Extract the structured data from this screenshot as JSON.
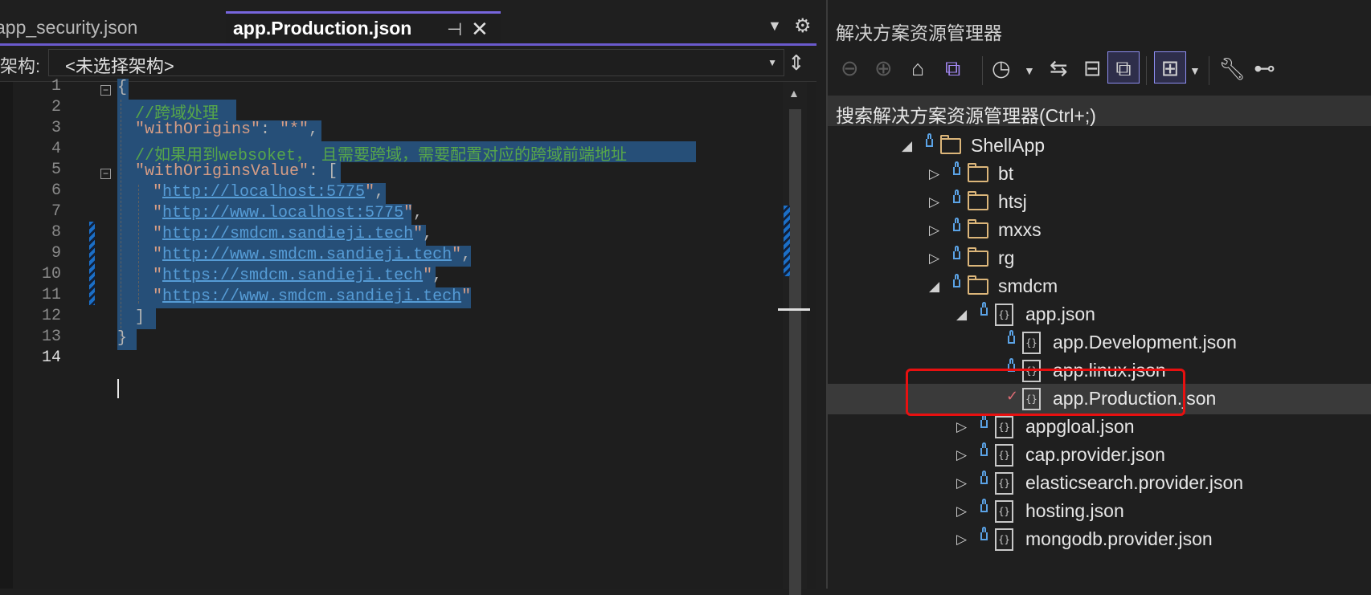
{
  "editor": {
    "tabs": [
      {
        "label": "app_security.json",
        "active": false
      },
      {
        "label": "app.Production.json",
        "active": true
      }
    ],
    "pin_glyph": "⊣",
    "close_glyph": "✕",
    "nav_label": "架构:",
    "nav_value": "<未选择架构>",
    "line_numbers": [
      "1",
      "2",
      "3",
      "4",
      "5",
      "6",
      "7",
      "8",
      "9",
      "10",
      "11",
      "12",
      "13",
      "14"
    ],
    "current_line": "14",
    "code": {
      "l1": "{",
      "l2": "//跨域处理",
      "l3_key": "\"withOrigins\"",
      "l3_colon": ": ",
      "l3_val": "\"*\"",
      "l3_end": ",",
      "l4": "//如果用到websoket， 且需要跨域，需要配置对应的跨域前端地址",
      "l5_key": "\"withOriginsValue\"",
      "l5_rest": ": [",
      "urls": [
        "http://localhost:5775",
        "http://www.localhost:5775",
        "http://smdcm.sandieji.tech",
        "http://www.smdcm.sandieji.tech",
        "https://smdcm.sandieji.tech",
        "https://www.smdcm.sandieji.tech"
      ],
      "l12": "]",
      "l13": "}"
    }
  },
  "solution_explorer": {
    "title": "解决方案资源管理器",
    "search_placeholder": "搜索解决方案资源管理器(Ctrl+;)",
    "toolbar_icons": [
      "back-icon",
      "forward-icon",
      "home-icon",
      "vs-solution-icon",
      "history-icon",
      "dropdown-icon",
      "sync-icon",
      "collapse-all-icon",
      "show-all-files-icon",
      "tree-view-icon",
      "dropdown-icon",
      "properties-wrench-icon",
      "preview-icon"
    ],
    "tree": [
      {
        "label": "ShellApp",
        "type": "folder",
        "expanded": true,
        "status": "lock"
      },
      {
        "label": "bt",
        "type": "folder",
        "expanded": false,
        "status": "lock"
      },
      {
        "label": "htsj",
        "type": "folder",
        "expanded": false,
        "status": "lock"
      },
      {
        "label": "mxxs",
        "type": "folder",
        "expanded": false,
        "status": "lock"
      },
      {
        "label": "rg",
        "type": "folder",
        "expanded": false,
        "status": "lock"
      },
      {
        "label": "smdcm",
        "type": "folder",
        "expanded": true,
        "status": "lock"
      },
      {
        "label": "app.json",
        "type": "json",
        "expanded": true,
        "status": "lock"
      },
      {
        "label": "app.Development.json",
        "type": "json",
        "status": "lock"
      },
      {
        "label": "app.linux.json",
        "type": "json",
        "status": "lock"
      },
      {
        "label": "app.Production.json",
        "type": "json",
        "status": "checked",
        "selected": true
      },
      {
        "label": "appgloal.json",
        "type": "json",
        "expanded": false,
        "status": "lock"
      },
      {
        "label": "cap.provider.json",
        "type": "json",
        "expanded": false,
        "status": "lock"
      },
      {
        "label": "elasticsearch.provider.json",
        "type": "json",
        "expanded": false,
        "status": "lock"
      },
      {
        "label": "hosting.json",
        "type": "json",
        "expanded": false,
        "status": "lock"
      },
      {
        "label": "mongodb.provider.json",
        "type": "json",
        "expanded": false,
        "status": "lock"
      }
    ]
  },
  "colors": {
    "accent": "#6a5acd",
    "selection": "#264f78",
    "comment": "#57a64a",
    "string": "#d69d85",
    "link": "#569cd6",
    "highlight_box": "#e81010"
  }
}
